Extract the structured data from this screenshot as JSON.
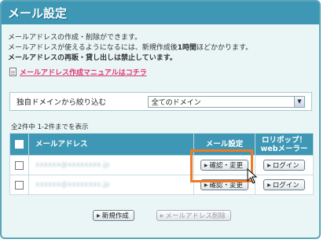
{
  "page": {
    "title": "メール設定",
    "intro_line1": "メールアドレスの作成・削除ができます。",
    "intro_line2_pre": "メールアドレスが使えるようになるには、新規作成後",
    "intro_line2_bold": "1時間",
    "intro_line2_post": "ほどかかります。",
    "intro_line3": "メールアドレスの再販・貸し出しは禁止しています。",
    "manual_link": "メールアドレス作成マニュアルはコチラ"
  },
  "filter": {
    "label": "独自ドメインから絞り込む",
    "selected": "全てのドメイン"
  },
  "count_text": "全2件中 1-2件までを表示",
  "table": {
    "headers": {
      "email": "メールアドレス",
      "settings": "メール設定",
      "webmail_line1": "ロリポップ！",
      "webmail_line2": "webメーラー"
    },
    "rows": [
      {
        "email": "xxxxxx@xxxxxxxx.jp",
        "confirm_label": "確認・変更",
        "login_label": "ログイン"
      },
      {
        "email": "xxxxxx@xxxxxxxx.jp",
        "confirm_label": "確認・変更",
        "login_label": "ログイン"
      }
    ]
  },
  "actions": {
    "new_label": "新規作成",
    "delete_label": "メールアドレス削除"
  },
  "colors": {
    "header": "#3d97b5",
    "background": "#eaf6f6",
    "link": "#e0386f",
    "highlight": "#f07a25"
  },
  "icons": {
    "manual": "document-icon",
    "dropdown": "chevron-down-icon",
    "pointer": "mouse-cursor-icon"
  }
}
